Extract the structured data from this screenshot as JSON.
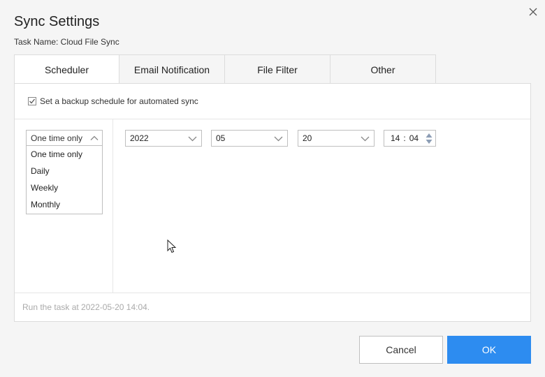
{
  "dialog": {
    "title": "Sync Settings",
    "task_name": "Task Name: Cloud File Sync"
  },
  "tabs": [
    {
      "label": "Scheduler",
      "active": true
    },
    {
      "label": "Email Notification",
      "active": false
    },
    {
      "label": "File Filter",
      "active": false
    },
    {
      "label": "Other",
      "active": false
    }
  ],
  "scheduler": {
    "checkbox_label": "Set a backup schedule for automated sync",
    "checkbox_checked": true,
    "frequency": {
      "selected": "One time only",
      "options": [
        "One time only",
        "Daily",
        "Weekly",
        "Monthly"
      ]
    },
    "date": {
      "year": "2022",
      "month": "05",
      "day": "20"
    },
    "time": {
      "hour": "14",
      "separator": ":",
      "minute": "04"
    },
    "status": "Run the task at 2022-05-20 14:04."
  },
  "buttons": {
    "cancel": "Cancel",
    "ok": "OK"
  },
  "colors": {
    "accent": "#2d8cf0",
    "border": "#dcdcdc",
    "status_text": "#aaaaaa"
  }
}
